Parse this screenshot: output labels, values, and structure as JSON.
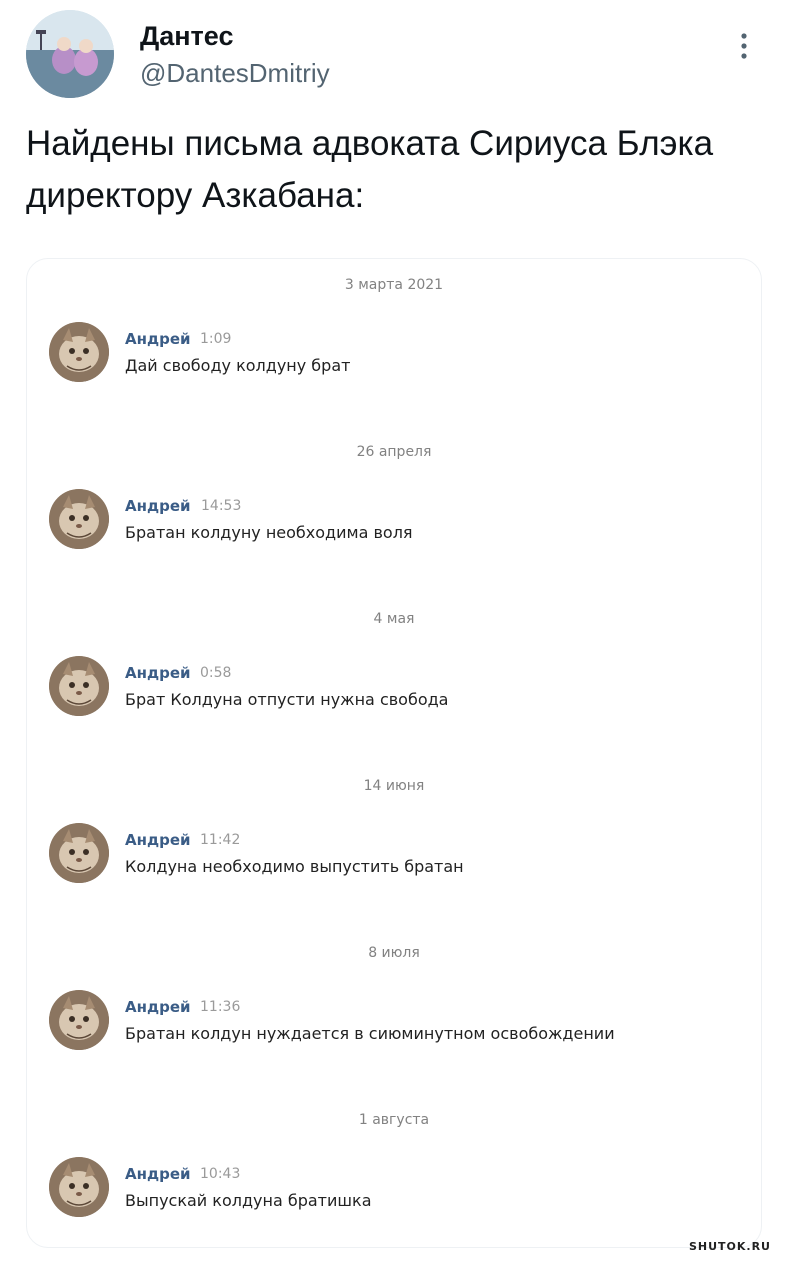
{
  "tweet": {
    "author_name": "Дантес",
    "author_handle": "@DantesDmitriy",
    "text": "Найдены письма адвоката Сириуса Блэка директору Азкабана:"
  },
  "chat": {
    "messages": [
      {
        "date": "3 марта 2021",
        "author": "Андрей",
        "time": "1:09",
        "text": "Дай свободу колдуну брат"
      },
      {
        "date": "26 апреля",
        "author": "Андрей",
        "time": "14:53",
        "text": "Братан колдуну необходима воля"
      },
      {
        "date": "4 мая",
        "author": "Андрей",
        "time": "0:58",
        "text": "Брат Колдуна отпусти нужна свобода"
      },
      {
        "date": "14 июня",
        "author": "Андрей",
        "time": "11:42",
        "text": "Колдуна необходимо выпустить братан"
      },
      {
        "date": "8 июля",
        "author": "Андрей",
        "time": "11:36",
        "text": "Братан колдун нуждается в сиюминутном освобождении"
      },
      {
        "date": "1 августа",
        "author": "Андрей",
        "time": "10:43",
        "text": "Выпускай колдуна братишка"
      }
    ]
  },
  "watermark": "SHUTOK.RU",
  "icons": {
    "more": "more-vertical-icon"
  },
  "colors": {
    "handle": "#536471",
    "chat_author": "#3a5c86",
    "chat_time": "#9a9a9a"
  }
}
